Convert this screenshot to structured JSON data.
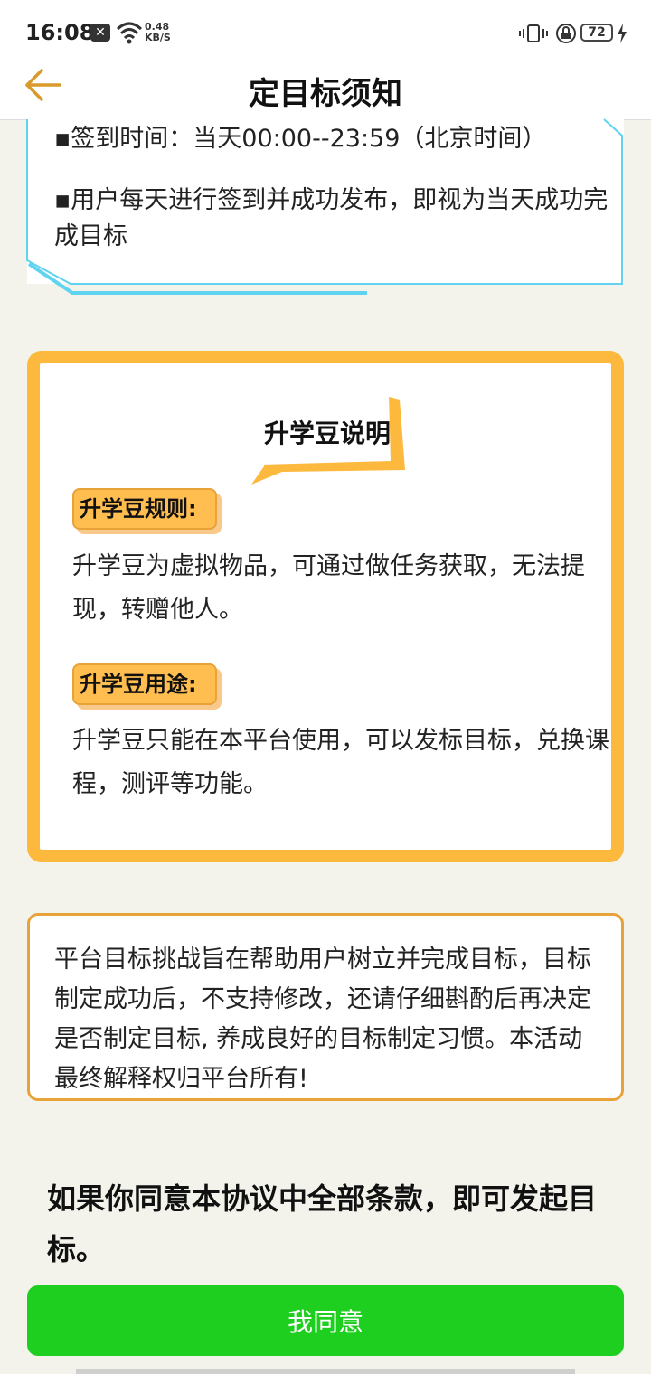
{
  "status_bar": {
    "time": "16:08",
    "notification_badge": "✕",
    "net_speed_value": "0.48",
    "net_speed_unit": "KB/S",
    "battery": "72",
    "icons": [
      "x-notification-icon",
      "wifi-icon",
      "vibrate-icon",
      "lock-rotation-icon",
      "battery-icon",
      "charging-icon"
    ]
  },
  "header": {
    "title": "定目标须知",
    "back_icon": "back-arrow-icon"
  },
  "checkin_card": {
    "line1": "▪签到时间：当天00:00--23:59（北京时间）",
    "line2": "▪用户每天进行签到并成功发布，即视为当天成功完成目标"
  },
  "beans_card": {
    "title": "升学豆说明",
    "rules_label": "升学豆规则:",
    "rules_text": "升学豆为虚拟物品，可通过做任务获取，无法提现，转赠他人。",
    "usage_label": "升学豆用途:",
    "usage_text": "升学豆只能在本平台使用，可以发标目标，兑换课程，测评等功能。"
  },
  "notice_card": {
    "text": "平台目标挑战旨在帮助用户树立并完成目标，目标制定成功后，不支持修改，还请仔细斟酌后再决定是否制定目标, 养成良好的目标制定习惯。本活动最终解释权归平台所有!"
  },
  "agreement": {
    "prompt": "如果你同意本协议中全部条款，即可发起目标。",
    "button_label": "我同意"
  },
  "colors": {
    "accent_orange": "#fdb93d",
    "button_green": "#1fcf1f",
    "frame_cyan": "#5fd3f0",
    "back_arrow": "#d99a2b"
  }
}
